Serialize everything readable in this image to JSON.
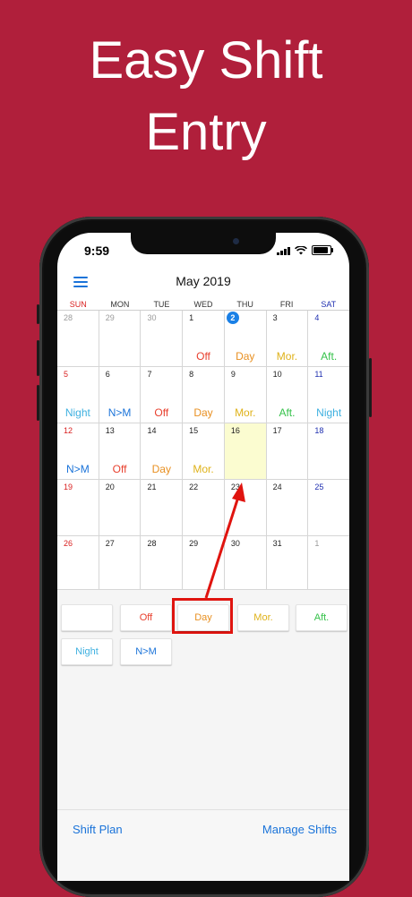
{
  "headline": [
    "Easy Shift",
    "Entry"
  ],
  "status": {
    "time": "9:59"
  },
  "nav": {
    "title": "May 2019"
  },
  "colors": {
    "background": "#b01f3b",
    "accent": "#1a73d9",
    "Off": "#e8402e",
    "Day": "#e89022",
    "Mor.": "#dfb21a",
    "Aft.": "#35c24a",
    "Night": "#3eb0e0",
    "N>M": "#1a73d9",
    "sunday": "#d92020",
    "saturday": "#1f2fb0",
    "other_month": "#9a9a9a"
  },
  "weekdays": [
    "SUN",
    "MON",
    "TUE",
    "WED",
    "THU",
    "FRI",
    "SAT"
  ],
  "calendar": {
    "today": "2",
    "selected": "16",
    "weeks": [
      [
        {
          "day": "28",
          "other": true,
          "shift": ""
        },
        {
          "day": "29",
          "other": true,
          "shift": ""
        },
        {
          "day": "30",
          "other": true,
          "shift": ""
        },
        {
          "day": "1",
          "shift": "Off"
        },
        {
          "day": "2",
          "shift": "Day"
        },
        {
          "day": "3",
          "shift": "Mor."
        },
        {
          "day": "4",
          "shift": "Aft."
        }
      ],
      [
        {
          "day": "5",
          "shift": "Night"
        },
        {
          "day": "6",
          "shift": "N>M"
        },
        {
          "day": "7",
          "shift": "Off"
        },
        {
          "day": "8",
          "shift": "Day"
        },
        {
          "day": "9",
          "shift": "Mor."
        },
        {
          "day": "10",
          "shift": "Aft."
        },
        {
          "day": "11",
          "shift": "Night"
        }
      ],
      [
        {
          "day": "12",
          "shift": "N>M"
        },
        {
          "day": "13",
          "shift": "Off"
        },
        {
          "day": "14",
          "shift": "Day"
        },
        {
          "day": "15",
          "shift": "Mor."
        },
        {
          "day": "16",
          "shift": ""
        },
        {
          "day": "17",
          "shift": ""
        },
        {
          "day": "18",
          "shift": ""
        }
      ],
      [
        {
          "day": "19",
          "shift": ""
        },
        {
          "day": "20",
          "shift": ""
        },
        {
          "day": "21",
          "shift": ""
        },
        {
          "day": "22",
          "shift": ""
        },
        {
          "day": "23",
          "shift": ""
        },
        {
          "day": "24",
          "shift": ""
        },
        {
          "day": "25",
          "shift": ""
        }
      ],
      [
        {
          "day": "26",
          "shift": ""
        },
        {
          "day": "27",
          "shift": ""
        },
        {
          "day": "28",
          "shift": ""
        },
        {
          "day": "29",
          "shift": ""
        },
        {
          "day": "30",
          "shift": ""
        },
        {
          "day": "31",
          "shift": ""
        },
        {
          "day": "1",
          "other": true,
          "shift": ""
        }
      ]
    ]
  },
  "palette": [
    {
      "label": ""
    },
    {
      "label": "Off"
    },
    {
      "label": "Day"
    },
    {
      "label": "Mor."
    },
    {
      "label": "Aft."
    },
    {
      "label": "Night"
    },
    {
      "label": "N>M"
    }
  ],
  "bottom": {
    "left_link": "Shift Plan",
    "right_link": "Manage Shifts"
  }
}
